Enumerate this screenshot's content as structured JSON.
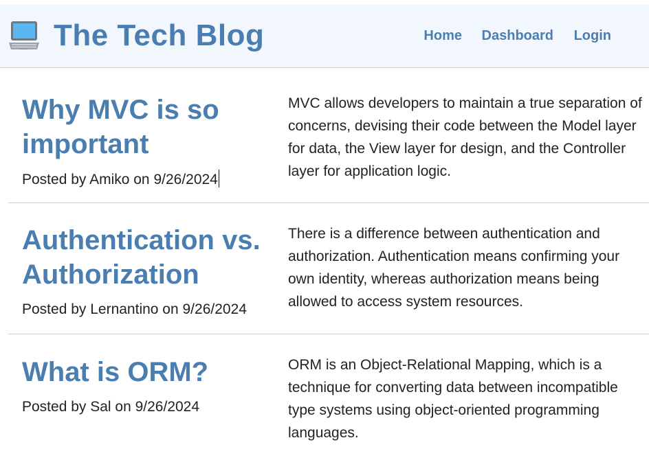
{
  "header": {
    "title": "The Tech Blog",
    "logo_icon": "laptop-icon",
    "nav": [
      {
        "label": "Home"
      },
      {
        "label": "Dashboard"
      },
      {
        "label": "Login"
      }
    ]
  },
  "posts": [
    {
      "title": "Why MVC is so important",
      "meta": "Posted by Amiko on 9/26/2024",
      "body": "MVC allows developers to maintain a true separation of concerns, devising their code between the Model layer for data, the View layer for design, and the Controller layer for application logic."
    },
    {
      "title": "Authentication vs. Authorization",
      "meta": "Posted by Lernantino on 9/26/2024",
      "body": "There is a difference between authentication and authorization. Authentication means confirming your own identity, whereas authorization means being allowed to access system resources."
    },
    {
      "title": "What is ORM?",
      "meta": "Posted by Sal on 9/26/2024",
      "body": "ORM is an Object-Relational Mapping, which is a technique for converting data between incompatible type systems using object-oriented programming languages."
    }
  ],
  "colors": {
    "accent": "#4a7eb0",
    "header_bg": "#f2f7fd",
    "text": "#222222"
  }
}
